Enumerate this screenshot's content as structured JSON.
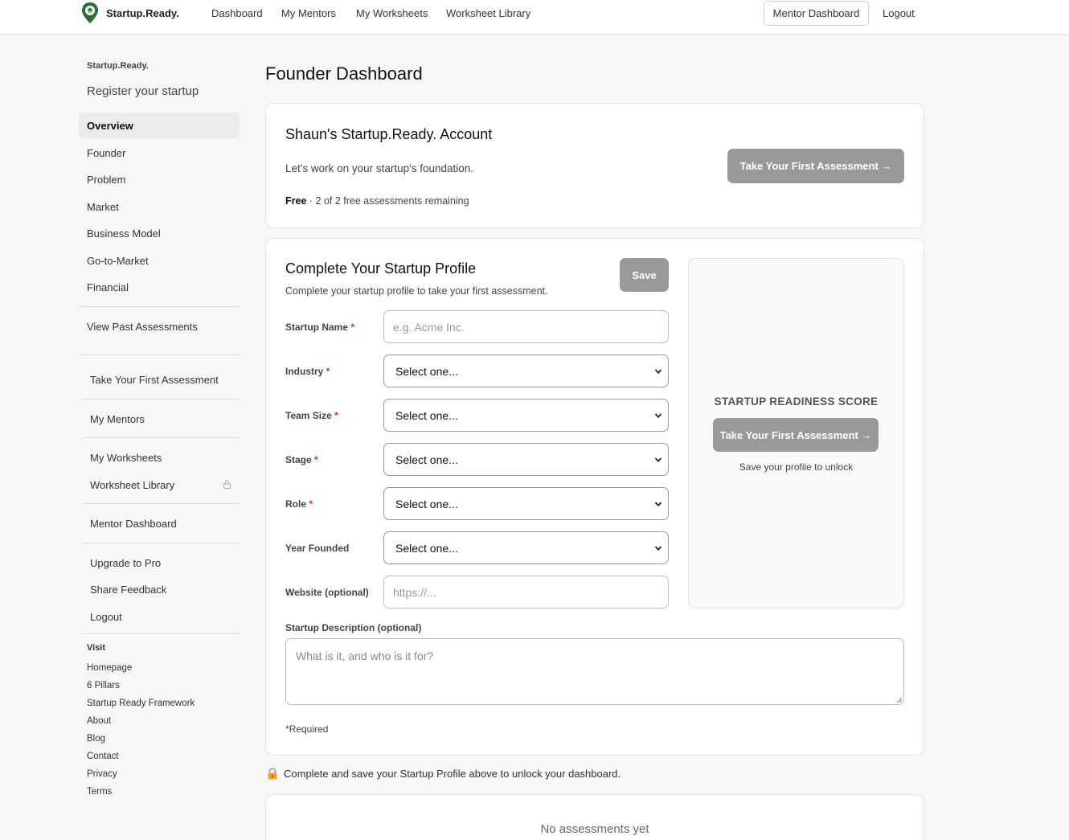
{
  "header": {
    "brand": "Startup.Ready.",
    "nav": [
      "Dashboard",
      "My Mentors",
      "My Worksheets",
      "Worksheet Library"
    ],
    "mentor_button": "Mentor Dashboard",
    "logout": "Logout"
  },
  "sidebar": {
    "brand": "Startup.Ready.",
    "register": "Register your startup",
    "sections": [
      "Overview",
      "Founder",
      "Problem",
      "Market",
      "Business Model",
      "Go-to-Market",
      "Financial"
    ],
    "past": "View Past Assessments",
    "first_assessment": "Take Your First Assessment",
    "mentors": "My Mentors",
    "worksheets": "My Worksheets",
    "library": "Worksheet Library",
    "mentor_dashboard": "Mentor Dashboard",
    "upgrade": "Upgrade to Pro",
    "feedback": "Share Feedback",
    "logout": "Logout",
    "visit_heading": "Visit",
    "visit_links": [
      "Homepage",
      "6 Pillars",
      "Startup Ready Framework",
      "About",
      "Blog",
      "Contact",
      "Privacy",
      "Terms"
    ]
  },
  "main": {
    "title": "Founder Dashboard",
    "account": {
      "title": "Shaun's Startup.Ready. Account",
      "subtitle": "Let's work on your startup's foundation.",
      "plan": "Free",
      "plan_detail": " · 2 of 2 free assessments remaining",
      "cta": "Take Your First Assessment →"
    },
    "profile": {
      "title": "Complete Your Startup Profile",
      "subtitle": "Complete your startup profile to take your first assessment.",
      "save": "Save",
      "fields": {
        "name_label": "Startup Name",
        "name_placeholder": "e.g. Acme Inc.",
        "industry_label": "Industry",
        "team_label": "Team Size",
        "stage_label": "Stage",
        "role_label": "Role",
        "year_label": "Year Founded",
        "website_label": "Website (optional)",
        "website_placeholder": "https://...",
        "select_placeholder": "Select one...",
        "desc_label": "Startup Description (optional)",
        "desc_placeholder": "What is it, and who is it for?",
        "required_mark": "*"
      },
      "required_note": "*Required"
    },
    "score": {
      "title": "STARTUP READINESS SCORE",
      "cta": "Take Your First Assessment →",
      "note": "Save your profile to unlock"
    },
    "unlock_message": "Complete and save your Startup Profile above to unlock your dashboard.",
    "no_assessments": "No assessments yet"
  },
  "colors": {
    "button_gray": "#999999",
    "required": "#c0392b",
    "logo_green": "#2e6b3a",
    "active_bg": "#ebebeb"
  }
}
